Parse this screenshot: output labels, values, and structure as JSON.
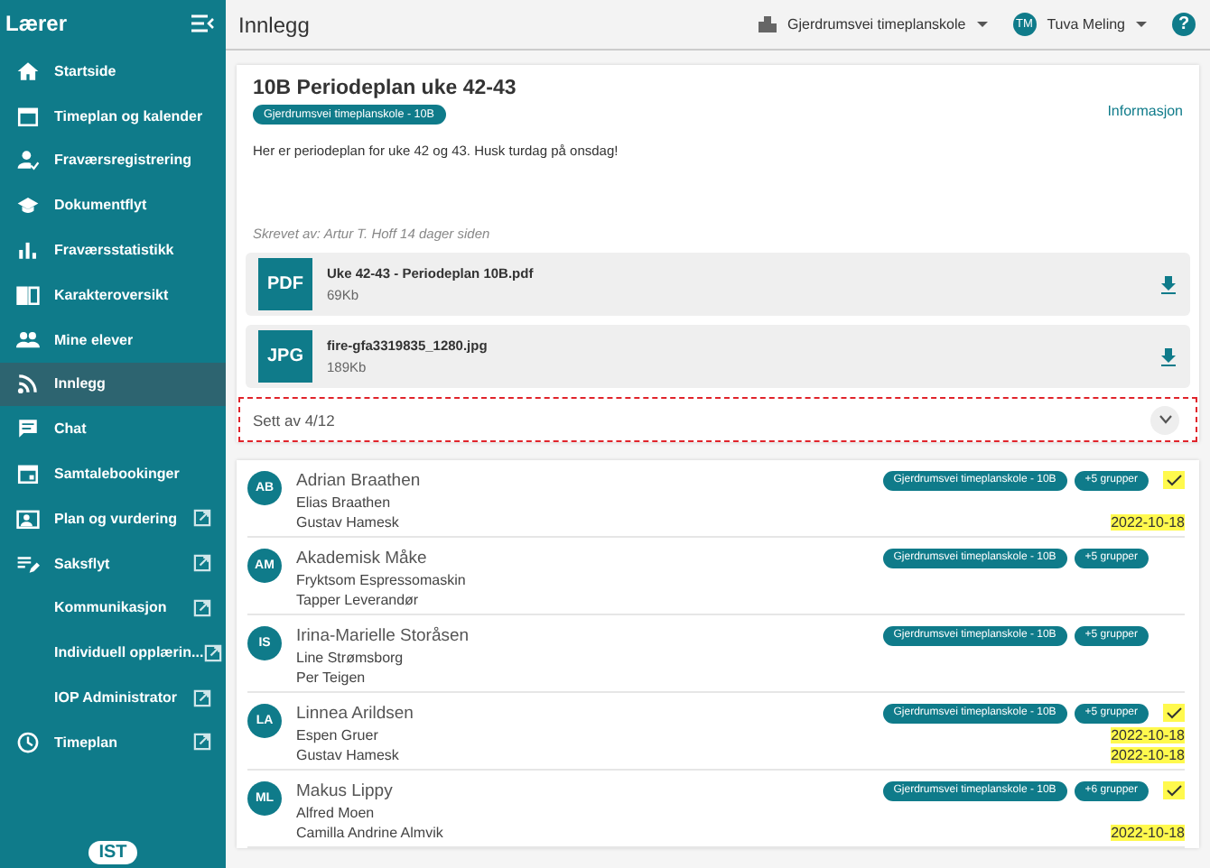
{
  "sidebar": {
    "title": "Lærer",
    "items": [
      {
        "label": "Startside",
        "external": false,
        "selected": false
      },
      {
        "label": "Timeplan og kalender",
        "external": false,
        "selected": false
      },
      {
        "label": "Fraværsregistrering",
        "external": false,
        "selected": false
      },
      {
        "label": "Dokumentflyt",
        "external": false,
        "selected": false
      },
      {
        "label": "Fraværsstatistikk",
        "external": false,
        "selected": false
      },
      {
        "label": "Karakteroversikt",
        "external": false,
        "selected": false
      },
      {
        "label": "Mine elever",
        "external": false,
        "selected": false
      },
      {
        "label": "Innlegg",
        "external": false,
        "selected": true
      },
      {
        "label": "Chat",
        "external": false,
        "selected": false
      },
      {
        "label": "Samtalebookinger",
        "external": false,
        "selected": false
      },
      {
        "label": "Plan og vurdering",
        "external": true,
        "selected": false
      },
      {
        "label": "Saksflyt",
        "external": true,
        "selected": false
      },
      {
        "label": "Kommunikasjon",
        "external": true,
        "selected": false
      },
      {
        "label": "Individuell opplærin...",
        "external": true,
        "selected": false
      },
      {
        "label": "IOP Administrator",
        "external": true,
        "selected": false
      },
      {
        "label": "Timeplan",
        "external": true,
        "selected": false
      }
    ],
    "logo": "IST"
  },
  "header": {
    "title": "Innlegg",
    "school": "Gjerdrumsvei timeplanskole",
    "user_initials": "TM",
    "user_name": "Tuva Meling",
    "help": "?"
  },
  "post": {
    "title": "10B Periodeplan uke 42-43",
    "tag": "Gjerdrumsvei timeplanskole - 10B",
    "info_link": "Informasjon",
    "body": "Her er periodeplan for uke 42 og 43. Husk turdag på onsdag!",
    "author": "Skrevet av: Artur T. Hoff 14 dager siden",
    "attachments": [
      {
        "type": "PDF",
        "name": "Uke 42-43 - Periodeplan 10B.pdf",
        "size": "69Kb"
      },
      {
        "type": "JPG",
        "name": "fire-gfa3319835_1280.jpg",
        "size": "189Kb"
      }
    ],
    "seen": {
      "label": "Sett av 4/12",
      "expanded": true,
      "highlighted": true
    }
  },
  "students": [
    {
      "initials": "AB",
      "name": "Adrian Braathen",
      "group": "Gjerdrumsvei timeplanskole - 10B",
      "more_groups": "+5 grupper",
      "seen": true,
      "guardians": [
        {
          "name": "Elias Braathen"
        },
        {
          "name": "Gustav Hamesk",
          "seen_date": "2022-10-18"
        }
      ]
    },
    {
      "initials": "AM",
      "name": "Akademisk Måke",
      "group": "Gjerdrumsvei timeplanskole - 10B",
      "more_groups": "+5 grupper",
      "seen": false,
      "guardians": [
        {
          "name": "Fryktsom Espressomaskin"
        },
        {
          "name": "Tapper Leverandør"
        }
      ]
    },
    {
      "initials": "IS",
      "name": "Irina-Marielle Storåsen",
      "group": "Gjerdrumsvei timeplanskole - 10B",
      "more_groups": "+5 grupper",
      "seen": false,
      "guardians": [
        {
          "name": "Line Strømsborg"
        },
        {
          "name": "Per Teigen"
        }
      ]
    },
    {
      "initials": "LA",
      "name": "Linnea Arildsen",
      "group": "Gjerdrumsvei timeplanskole - 10B",
      "more_groups": "+5 grupper",
      "seen": true,
      "guardians": [
        {
          "name": "Espen Gruer",
          "seen_date": "2022-10-18"
        },
        {
          "name": "Gustav Hamesk",
          "seen_date": "2022-10-18"
        }
      ]
    },
    {
      "initials": "ML",
      "name": "Makus Lippy",
      "group": "Gjerdrumsvei timeplanskole - 10B",
      "more_groups": "+6 grupper",
      "seen": true,
      "guardians": [
        {
          "name": "Alfred Moen"
        },
        {
          "name": "Camilla Andrine Almvik",
          "seen_date": "2022-10-18"
        }
      ]
    }
  ]
}
